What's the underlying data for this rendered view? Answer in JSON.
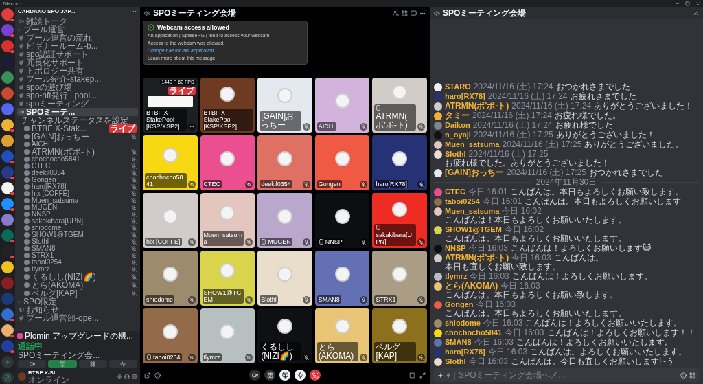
{
  "window": {
    "title": "Discord"
  },
  "servers": [
    {
      "color": "#e23e3e",
      "unread": true
    },
    {
      "color": "#7b3fd1",
      "unread": true
    },
    {
      "color": "#d93030",
      "unread": true
    },
    {
      "color": "#1c1c3a",
      "unread": false
    },
    {
      "color": "#3a8f5a",
      "unread": false
    },
    {
      "color": "#c94a2e",
      "unread": false
    },
    {
      "color": "#5865f2",
      "unread": false
    },
    {
      "color": "#f0b232",
      "unread": true
    },
    {
      "color": "#e0a030",
      "unread": false
    },
    {
      "color": "#2050c0",
      "unread": true
    },
    {
      "color": "#2a3a8a",
      "unread": true
    },
    {
      "color": "#f4f4f4",
      "unread": true
    },
    {
      "color": "#1e90ff",
      "unread": true
    },
    {
      "color": "#8a7ad0",
      "unread": false
    },
    {
      "color": "#0a6a5a",
      "unread": true
    },
    {
      "color": "#222222",
      "unread": true
    },
    {
      "color": "#f0c020",
      "unread": false
    },
    {
      "color": "#8a2020",
      "unread": false
    },
    {
      "color": "#1a3a7a",
      "unread": false
    },
    {
      "color": "#3070d0",
      "unread": true
    },
    {
      "color": "#e8b070",
      "unread": true
    },
    {
      "color": "#2040a0",
      "unread": true
    }
  ],
  "server": {
    "name": "CARDANO SPO JAP..."
  },
  "channels": [
    {
      "kind": "voice",
      "name": "雑談トーク",
      "selected": false
    },
    {
      "kind": "category",
      "name": "プール運営"
    },
    {
      "kind": "text",
      "name": "プール運営の流れ",
      "selected": false
    },
    {
      "kind": "text",
      "name": "ビギナールーム-b...",
      "selected": false
    },
    {
      "kind": "text",
      "name": "spo認証サポート",
      "selected": false
    },
    {
      "kind": "text",
      "name": "冗長化サポート",
      "selected": false
    },
    {
      "kind": "text",
      "name": "トポロジー共有",
      "selected": false
    },
    {
      "kind": "text",
      "name": "プール紹介-stakep...",
      "selected": false
    },
    {
      "kind": "text",
      "name": "spoの遊び場",
      "selected": false
    },
    {
      "kind": "text",
      "name": "spo-nft発行 | pool...",
      "selected": false
    },
    {
      "kind": "text",
      "name": "spoミーティング",
      "selected": false
    },
    {
      "kind": "voice",
      "name": "SPOミーテ...",
      "selected": true,
      "status": "チャンネルステータスを設定",
      "members": [
        {
          "name": "BTBF X-Stak...",
          "live": "ライブ",
          "muted": false
        },
        {
          "name": "[GAIN]おっちー",
          "muted": true
        },
        {
          "name": "AICHI",
          "muted": false
        },
        {
          "name": "ATRMN(ボ'ボ-ト)",
          "muted": true
        },
        {
          "name": "chochocho5841",
          "muted": true
        },
        {
          "name": "CTEC",
          "muted": true
        },
        {
          "name": "deekil0354",
          "muted": true
        },
        {
          "name": "Gongen",
          "muted": true
        },
        {
          "name": "haro[RX78]",
          "muted": true
        },
        {
          "name": "hix [COFFE]",
          "muted": true
        },
        {
          "name": "Muen_satsuma",
          "muted": true
        },
        {
          "name": "MUGEN",
          "muted": true
        },
        {
          "name": "NNSP",
          "muted": true
        },
        {
          "name": "sakakibara[UPN]",
          "muted": true
        },
        {
          "name": "shiodome",
          "muted": true
        },
        {
          "name": "SHOW1@TGEM",
          "muted": true
        },
        {
          "name": "Slothl",
          "muted": true
        },
        {
          "name": "SMAN8",
          "muted": true
        },
        {
          "name": "STRX1",
          "muted": true
        },
        {
          "name": "taboi0254",
          "muted": true
        },
        {
          "name": "tlymrz",
          "muted": true
        },
        {
          "name": "くるしし(NIZI🌈)",
          "muted": true
        },
        {
          "name": "とら(AKOMA)",
          "muted": true
        },
        {
          "name": "ベルグ[KAP]",
          "muted": true
        }
      ]
    },
    {
      "kind": "category",
      "name": "SPO限定"
    },
    {
      "kind": "announce",
      "name": "お知らせ",
      "selected": false
    },
    {
      "kind": "text",
      "name": "プール運営部-ope...",
      "selected": false
    }
  ],
  "notice": {
    "text": "Plomin アップグレードの機..."
  },
  "voice_panel": {
    "status": "通話中",
    "channel": "SPOミーティング会..."
  },
  "user": {
    "name": "BTBF X-St...",
    "status": "オンライン"
  },
  "toast": {
    "title": "Webcam access allowed",
    "message": "An application [ SpreeeRG ] tried to access your webcam.",
    "detail": "Access to the webcam was allowed.",
    "link": "Change rule for this application",
    "footer": "Learn more about this message"
  },
  "stage": {
    "title": "SPOミーティング会場"
  },
  "tiles": [
    {
      "kind": "screen",
      "name": "BTBF X-StakePool [KSP/XSP2]",
      "quality": "1440 P 60 FPS",
      "live": "ライブ",
      "color": "#1e1f22",
      "muted": false,
      "mobile": false
    },
    {
      "kind": "camera",
      "name": "BTBF X-StakePool [KSP/KSP2]",
      "color": "#6e3a22",
      "muted": false,
      "mobile": false
    },
    {
      "kind": "camera",
      "name": "[GAIN]おっちー",
      "color": "#e4e9f0",
      "muted": true,
      "mobile": false
    },
    {
      "kind": "camera",
      "name": "AICHI",
      "color": "#d3b3dc",
      "muted": true,
      "mobile": false
    },
    {
      "kind": "camera",
      "name": "ATRMN(ボ'ボ-ト)",
      "color": "#d1ccc7",
      "muted": true,
      "mobile": true
    },
    {
      "kind": "camera",
      "name": "chochocho5841",
      "color": "#f7d812",
      "muted": true,
      "mobile": false
    },
    {
      "kind": "camera",
      "name": "CTEC",
      "color": "#eb4f90",
      "muted": true,
      "mobile": false
    },
    {
      "kind": "camera",
      "name": "deekil0354",
      "color": "#de7064",
      "muted": true,
      "mobile": false
    },
    {
      "kind": "camera",
      "name": "Gongen",
      "color": "#f05a45",
      "muted": true,
      "mobile": false
    },
    {
      "kind": "camera",
      "name": "haro[RX78]",
      "color": "#263276",
      "muted": true,
      "mobile": false
    },
    {
      "kind": "camera",
      "name": "hix [COFFE]",
      "color": "#d1cbc9",
      "muted": true,
      "mobile": false
    },
    {
      "kind": "camera",
      "name": "Muen_satsuma",
      "color": "#e3c6bd",
      "muted": true,
      "mobile": false
    },
    {
      "kind": "camera",
      "name": "MUGEN",
      "color": "#b9a8cc",
      "muted": true,
      "mobile": true
    },
    {
      "kind": "camera",
      "name": "NNSP",
      "color": "#0d0e11",
      "muted": true,
      "mobile": true
    },
    {
      "kind": "camera",
      "name": "sakakibara[UPN]",
      "color": "#ef2c24",
      "muted": true,
      "mobile": true
    },
    {
      "kind": "camera",
      "name": "shiodome",
      "color": "#9c8b6c",
      "muted": true,
      "mobile": false
    },
    {
      "kind": "camera",
      "name": "SHOW1@TGEM",
      "color": "#d8d44c",
      "muted": true,
      "mobile": false
    },
    {
      "kind": "camera",
      "name": "Slothl",
      "color": "#e9ddcb",
      "muted": true,
      "mobile": false
    },
    {
      "kind": "camera",
      "name": "SMAN8",
      "color": "#6470b4",
      "muted": true,
      "mobile": false
    },
    {
      "kind": "camera",
      "name": "STRX1",
      "color": "#ab9c86",
      "muted": true,
      "mobile": false
    },
    {
      "kind": "camera",
      "name": "taboi0254",
      "color": "#936a4a",
      "muted": true,
      "mobile": true
    },
    {
      "kind": "camera",
      "name": "tlymrz",
      "color": "#b8bfc1",
      "muted": true,
      "mobile": false
    },
    {
      "kind": "camera",
      "name": "くるしし(NIZI🌈)",
      "color": "#0f1014",
      "muted": true,
      "mobile": false
    },
    {
      "kind": "camera",
      "name": "とら(AKOMA)",
      "color": "#e8c474",
      "muted": true,
      "mobile": false
    },
    {
      "kind": "camera",
      "name": "ベルグ[KAP]",
      "color": "#8c701d",
      "muted": true,
      "mobile": false
    }
  ],
  "chat": {
    "title": "SPOミーティング会場",
    "placeholder": "♦｜SPOミーティング会場へメ...",
    "messages": [
      {
        "kind": "message",
        "author": "STARO",
        "time": "2024/11/16 (土) 17:24",
        "lines": [
          "おつかれさまでした"
        ],
        "color": "#f2f2f2"
      },
      {
        "kind": "message",
        "author": "haro[RX78]",
        "time": "2024/11/16 (土) 17:24",
        "lines": [
          "お疲れさまでした"
        ],
        "color": "#263276"
      },
      {
        "kind": "message",
        "author": "ATRMN(ボ'ボ-ト)",
        "time": "2024/11/16 (土) 17:24",
        "lines": [
          "ありがとうございました！"
        ],
        "color": "#d1ccc7"
      },
      {
        "kind": "message",
        "author": "タミー",
        "time": "2024/11/16 (土) 17:24",
        "lines": [
          "お疲れ様でした。"
        ],
        "color": "#f0b232"
      },
      {
        "kind": "message",
        "author": "Daikon",
        "time": "2024/11/16 (土) 17:24",
        "lines": [
          "お疲れ様でした"
        ],
        "color": "#80848e"
      },
      {
        "kind": "message",
        "author": "n_oyaji",
        "time": "2024/11/16 (土) 17:25",
        "lines": [
          "ありがとうございました！"
        ],
        "color": "#111111"
      },
      {
        "kind": "message",
        "author": "Muen_satsuma",
        "time": "2024/11/16 (土) 17:25",
        "lines": [
          "ありがとうございました。"
        ],
        "color": "#e3c6bd"
      },
      {
        "kind": "message",
        "author": "Slothl",
        "time": "2024/11/16 (土) 17:25",
        "lines": [
          "お疲れ様でした。ありがとうございました！"
        ],
        "color": "#e9ddcb"
      },
      {
        "kind": "message",
        "author": "[GAIN]おっちー",
        "time": "2024/11/16 (土) 17:25",
        "lines": [
          "おつかれさまでした"
        ],
        "color": "#e4e9f0"
      },
      {
        "kind": "divider",
        "text": "2024年11月30日"
      },
      {
        "kind": "message",
        "author": "CTEC",
        "time": "今日 16:01",
        "lines": [
          "こんばんは。本日もよろしくお願い致します。"
        ],
        "color": "#eb4f90"
      },
      {
        "kind": "message",
        "author": "taboi0254",
        "time": "今日 16:01",
        "lines": [
          "こんばんは。本日もよろしくお願いします"
        ],
        "color": "#936a4a"
      },
      {
        "kind": "message",
        "author": "Muen_satsuma",
        "time": "今日 16:02",
        "lines": [
          "こんばんは！本日もよろしくお願いいたします。"
        ],
        "color": "#e3c6bd"
      },
      {
        "kind": "message",
        "author": "SHOW1@TGEM",
        "time": "今日 16:02",
        "lines": [
          "こんばんは。本日もよろしくお願いいたします。"
        ],
        "color": "#d8d44c"
      },
      {
        "kind": "message",
        "author": "NNSP",
        "time": "今日 16:03",
        "lines": [
          "こんばんは！よろしくお願いします😺"
        ],
        "color": "#0d0e11"
      },
      {
        "kind": "message",
        "author": "ATRMN(ボ'ボ-ト)",
        "time": "今日 16:03",
        "lines": [
          "こんばんは。",
          "本日も宜しくお願い致します。"
        ],
        "color": "#d1ccc7"
      },
      {
        "kind": "message",
        "author": "tlymrz",
        "time": "今日 16:03",
        "lines": [
          "こんばんは！よろしくお願いします。"
        ],
        "color": "#b8bfc1"
      },
      {
        "kind": "message",
        "author": "とら(AKOMA)",
        "time": "今日 16:03",
        "lines": [
          "こんばんは。本日もよろしくお願い致します。"
        ],
        "color": "#e8c474"
      },
      {
        "kind": "message",
        "author": "Gongen",
        "time": "今日 16:03",
        "lines": [
          "こんばんは。本日もよろしくお願いいたします。"
        ],
        "color": "#f05a45"
      },
      {
        "kind": "message",
        "author": "shiodome",
        "time": "今日 16:03",
        "lines": [
          "こんばんは！よろしくお願いいたします。"
        ],
        "color": "#9c8b6c"
      },
      {
        "kind": "message",
        "author": "chochocho5841",
        "time": "今日 16:03",
        "lines": [
          "こんばんは！よろしくお願いします！！"
        ],
        "color": "#f7d812"
      },
      {
        "kind": "message",
        "author": "SMAN8",
        "time": "今日 16:03",
        "lines": [
          "こんばんは！よろしくお願いいたします。"
        ],
        "color": "#6470b4"
      },
      {
        "kind": "message",
        "author": "haro[RX78]",
        "time": "今日 16:03",
        "lines": [
          "こんばんは。よろしくお願いいたします。"
        ],
        "color": "#263276"
      },
      {
        "kind": "message",
        "author": "Slothl",
        "time": "今日 16:03",
        "lines": [
          "こんばんは。今日も宜しくお願いします!~う"
        ],
        "color": "#e9ddcb"
      }
    ]
  }
}
